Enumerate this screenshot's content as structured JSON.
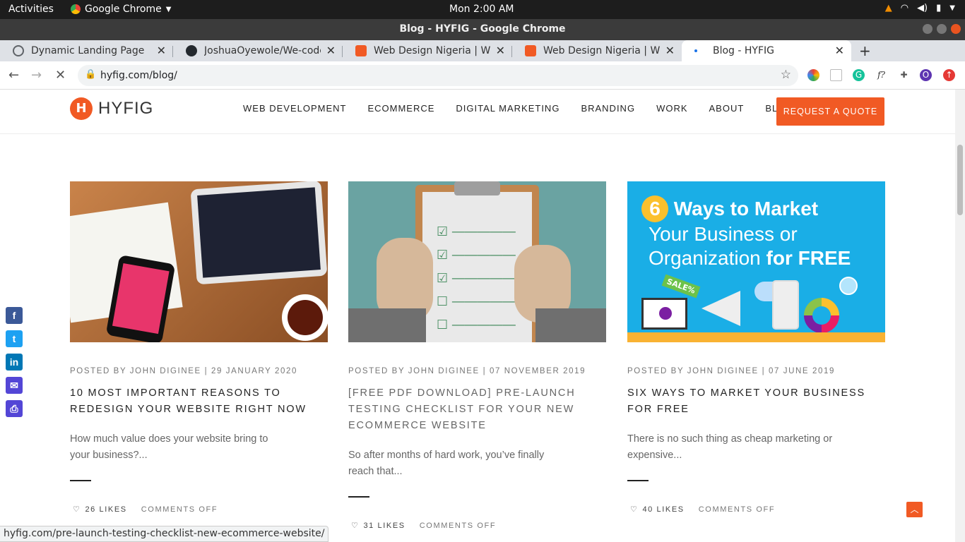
{
  "os": {
    "activities": "Activities",
    "app_name": "Google Chrome",
    "clock": "Mon  2:00 AM"
  },
  "window": {
    "title": "Blog - HYFIG - Google Chrome"
  },
  "tabs": [
    {
      "title": "Dynamic Landing Page",
      "favicon": "globe-icon",
      "color": "#5f6368"
    },
    {
      "title": "JoshuaOyewole/We-code",
      "favicon": "github-icon",
      "color": "#24292e"
    },
    {
      "title": "Web Design Nigeria | Web",
      "favicon": "hyfig-icon",
      "color": "#f15a24"
    },
    {
      "title": "Web Design Nigeria | Web",
      "favicon": "hyfig-icon",
      "color": "#f15a24"
    },
    {
      "title": "Blog - HYFIG",
      "favicon": "loading-icon",
      "color": "#1a73e8"
    }
  ],
  "omnibox": {
    "url": "hyfig.com/blog/"
  },
  "site": {
    "logo": "HYFIG",
    "menu": [
      "WEB DEVELOPMENT",
      "ECOMMERCE",
      "DIGITAL MARKETING",
      "BRANDING",
      "WORK",
      "ABOUT",
      "BLOG"
    ],
    "cta": "REQUEST A QUOTE",
    "accent": "#f15a24"
  },
  "posts": [
    {
      "meta": "POSTED BY JOHN DIGINEE | 29 JANUARY 2020",
      "title": "10 MOST IMPORTANT REASONS TO REDESIGN YOUR WEBSITE RIGHT NOW",
      "excerpt": "How much value does your website bring to your business?...",
      "likes": "26 LIKES",
      "comments": "COMMENTS OFF"
    },
    {
      "meta": "POSTED BY JOHN DIGINEE | 07 NOVEMBER 2019",
      "title": "[FREE PDF DOWNLOAD] PRE-LAUNCH TESTING CHECKLIST FOR YOUR NEW ECOMMERCE WEBSITE",
      "excerpt": "So after months of hard work, you’ve finally reach that...",
      "likes": "31 LIKES",
      "comments": "COMMENTS OFF"
    },
    {
      "meta": "POSTED BY JOHN DIGINEE | 07 JUNE 2019",
      "title": "SIX WAYS TO MARKET YOUR BUSINESS FOR FREE",
      "excerpt": "There is no such thing as cheap marketing or expensive...",
      "likes": "40 LIKES",
      "comments": "COMMENTS OFF"
    }
  ],
  "promo": {
    "number": "6",
    "line1": "Ways to Market",
    "line2": "Your Business or",
    "line3": "Organization",
    "line3b": "for FREE",
    "sale": "SALE%"
  },
  "status_url": "hyfig.com/pre-launch-testing-checklist-new-ecommerce-website/"
}
